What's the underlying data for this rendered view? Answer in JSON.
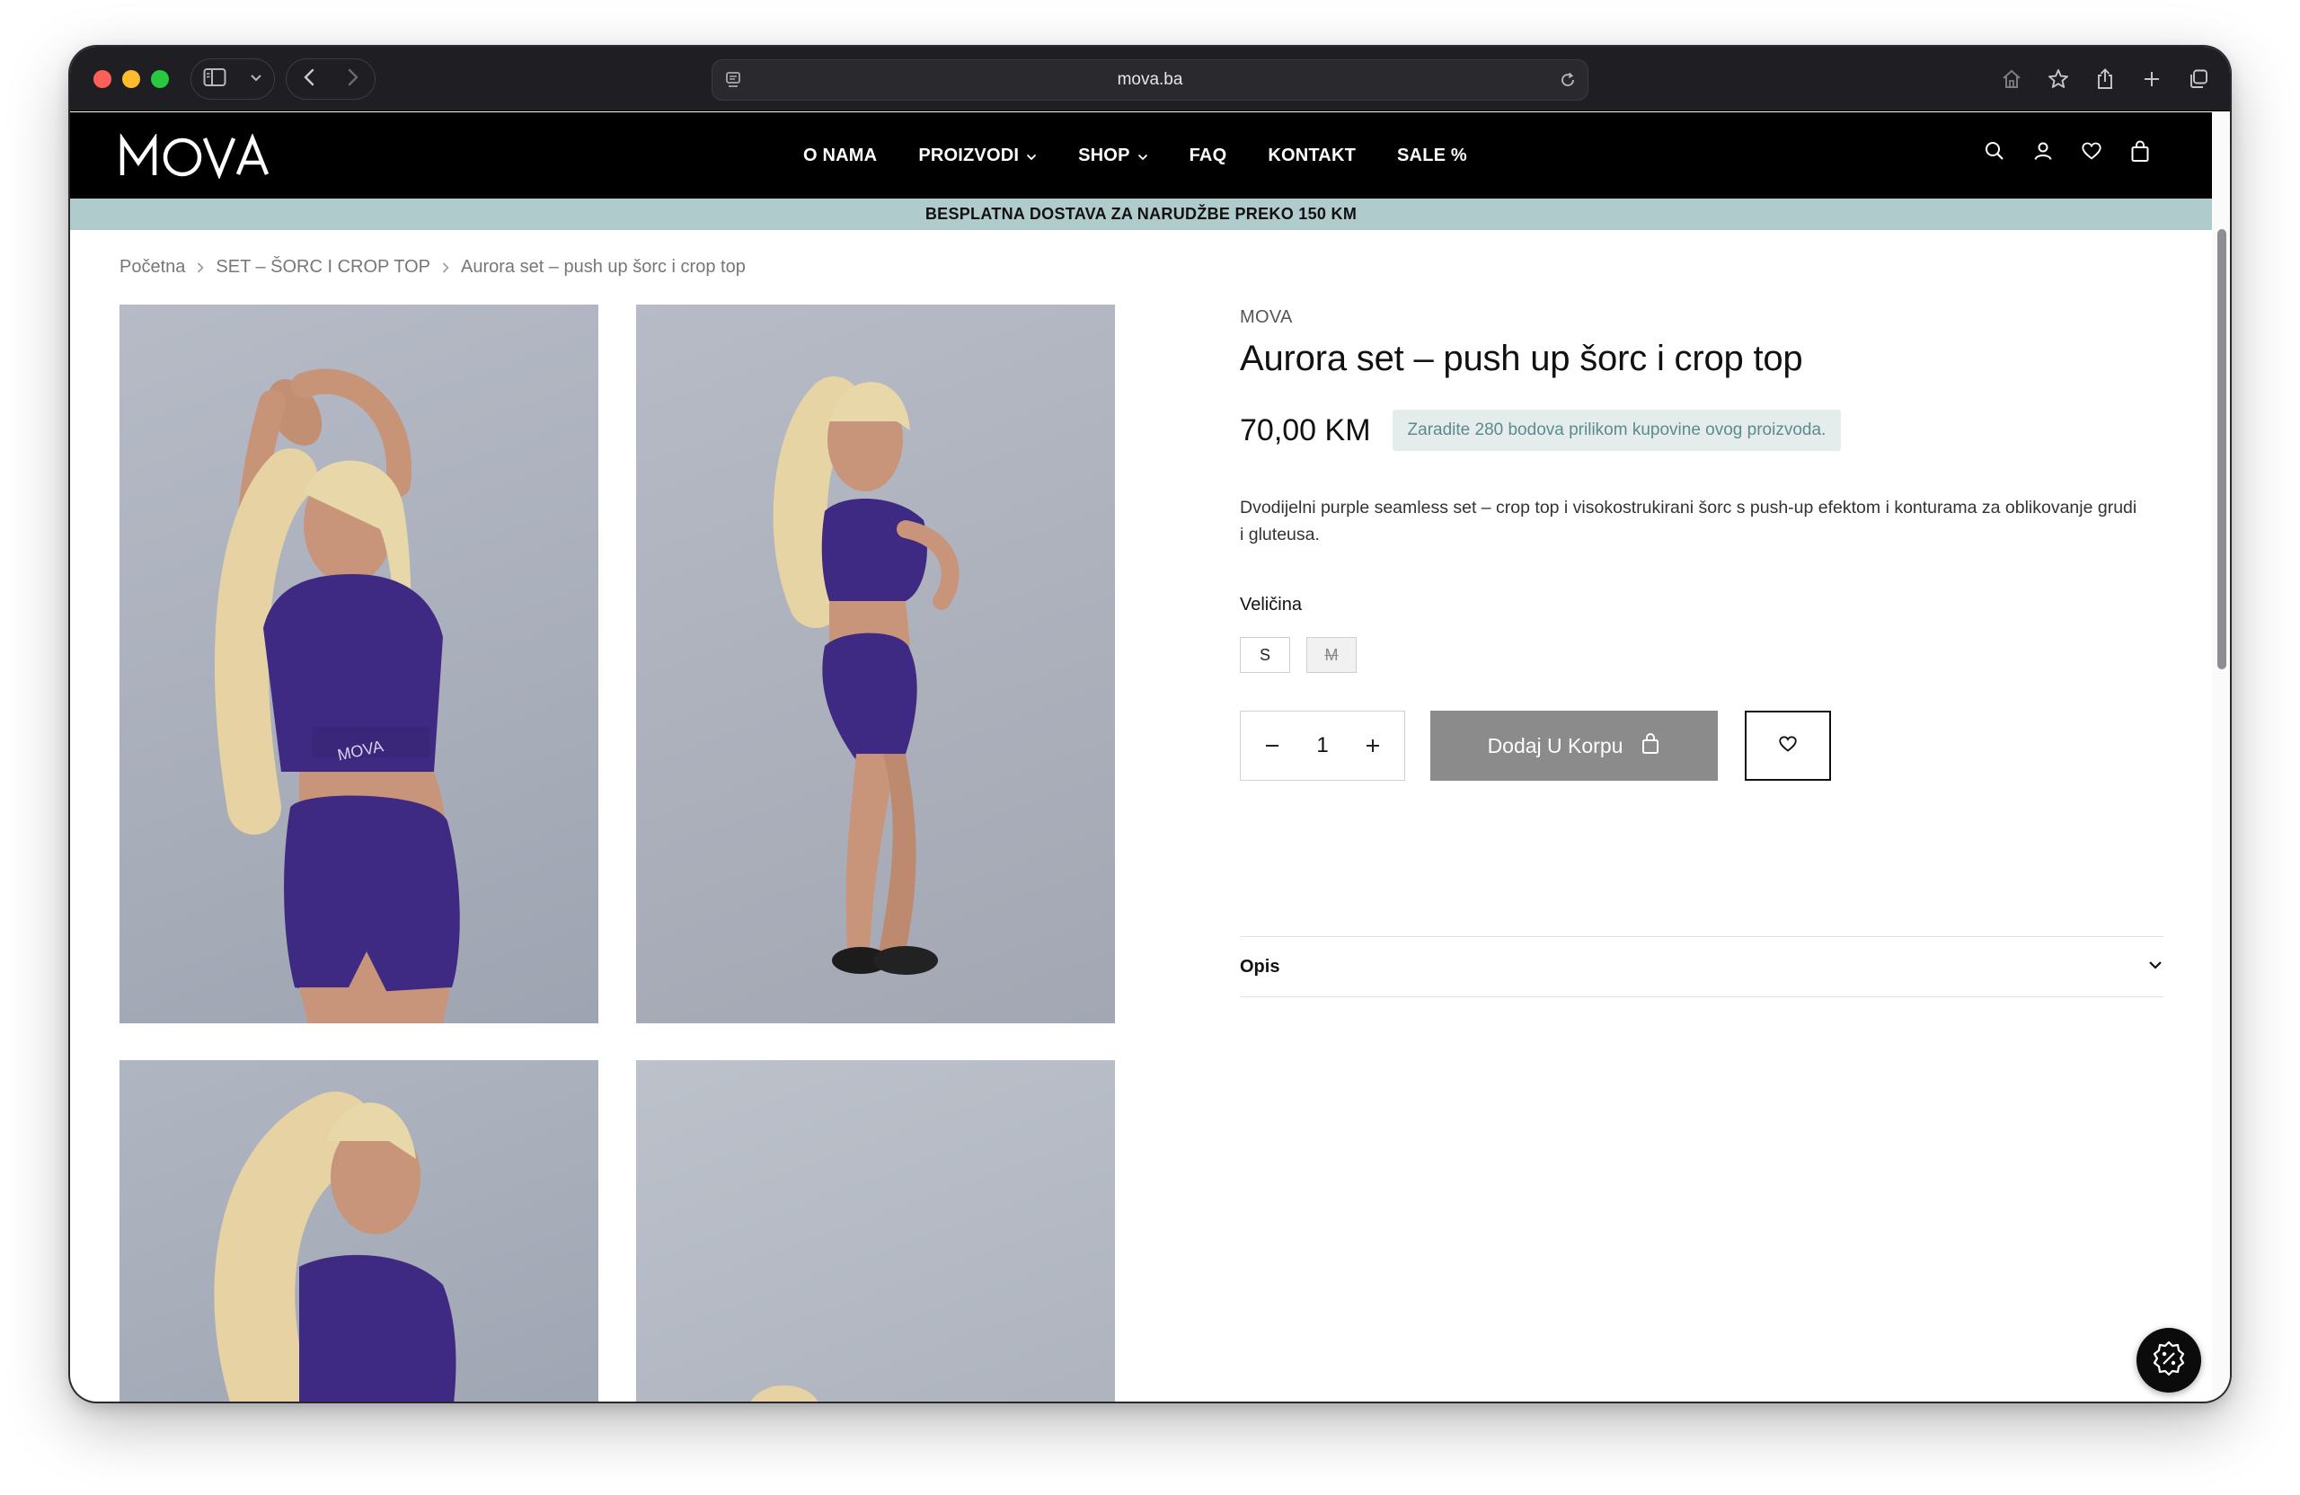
{
  "browser": {
    "url": "mova.ba"
  },
  "header": {
    "logo_text": "MOVA",
    "nav": [
      {
        "label": "O NAMA",
        "dropdown": false
      },
      {
        "label": "PROIZVODI",
        "dropdown": true
      },
      {
        "label": "SHOP",
        "dropdown": true
      },
      {
        "label": "FAQ",
        "dropdown": false
      },
      {
        "label": "KONTAKT",
        "dropdown": false
      },
      {
        "label": "SALE %",
        "dropdown": false
      }
    ],
    "icons": [
      "search-icon",
      "user-icon",
      "heart-icon",
      "bag-icon"
    ]
  },
  "promo": {
    "text": "BESPLATNA DOSTAVA ZA NARUDŽBE PREKO 150 KM"
  },
  "breadcrumb": [
    "Početna",
    "SET – ŠORC I CROP TOP",
    "Aurora set – push up šorc i crop top"
  ],
  "product": {
    "brand": "MOVA",
    "title": "Aurora set – push up šorc i crop top",
    "price": "70,00 KM",
    "points_text": "Zaradite 280 bodova prilikom kupovine ovog proizvoda.",
    "description": "Dvodijelni purple seamless set – crop top i visokostrukirani šorc s push-up efektom i konturama za oblikovanje grudi i gluteusa.",
    "size_label": "Veličina",
    "sizes": [
      {
        "label": "S",
        "available": true
      },
      {
        "label": "M",
        "available": false
      }
    ],
    "quantity": "1",
    "add_to_cart_label": "Dodaj U Korpu",
    "accordion_title": "Opis"
  },
  "colors": {
    "header_bg": "#000000",
    "promo_bg": "#afcbcc",
    "set_purple": "#3e2a82",
    "add_to_cart_bg": "#8b8b8b",
    "points_bg": "#e4ecec"
  }
}
